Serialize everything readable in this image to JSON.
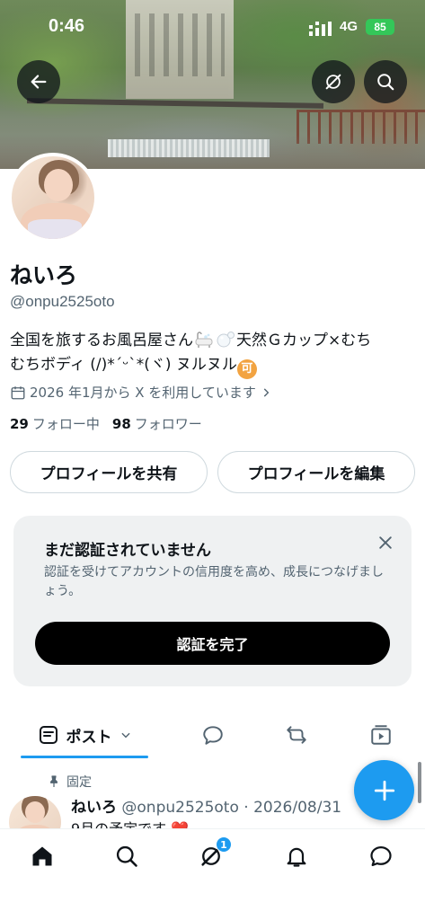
{
  "status_bar": {
    "time": "0:46",
    "network": "4G",
    "battery": "85"
  },
  "header": {
    "back_icon": "arrow-left-icon",
    "grok_icon": "grok-icon",
    "search_icon": "search-icon"
  },
  "profile": {
    "display_name": "ねいろ",
    "handle": "@onpu2525oto",
    "bio_line1": "全国を旅するお風呂屋さん",
    "bio_line1_tail": "天然Ｇカップ×むち",
    "bio_line2": "むちボディ (/)*´ᵕ`*(ヾ) ヌルヌル",
    "bio_badge": "可",
    "joined": "2026 年1月から X を利用しています",
    "following_count": "29",
    "following_label": "フォロー中",
    "followers_count": "98",
    "followers_label": "フォロワー"
  },
  "actions": {
    "share_label": "プロフィールを共有",
    "edit_label": "プロフィールを編集"
  },
  "verify_card": {
    "title": "まだ認証されていません",
    "description": "認証を受けてアカウントの信用度を高め、成長につなげましょう。",
    "button_label": "認証を完了"
  },
  "tabs": {
    "posts_label": "ポスト"
  },
  "pinned_post": {
    "pinned_label": "固定",
    "author": "ねいろ",
    "meta": "@onpu2525oto · 2026/08/31",
    "text": "9月の予定です ❤️"
  },
  "bottom_nav": {
    "grok_badge": "1"
  },
  "colors": {
    "accent": "#1d9bf0",
    "text_primary": "#0f1419",
    "text_secondary": "#536471",
    "battery_green": "#34c759"
  }
}
